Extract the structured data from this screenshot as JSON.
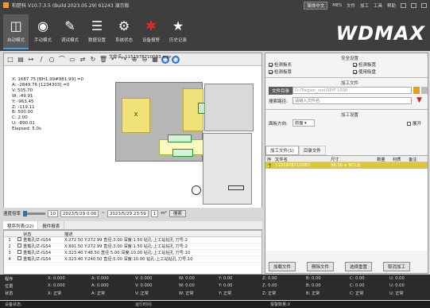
{
  "app": {
    "title": "柏楚科 V10.7.3.5 (Build 2023.05.29) 61243 演示版",
    "menu": [
      "简体中文",
      "MES",
      "文件",
      "加工",
      "工具",
      "帮助"
    ],
    "lang": "简体中文"
  },
  "modes": [
    {
      "label": "自动模式",
      "icon": "monitor-icon"
    },
    {
      "label": "手动模式",
      "icon": "mouse-icon"
    },
    {
      "label": "调试模式",
      "icon": "edit-icon"
    },
    {
      "label": "数据设置",
      "icon": "list-icon"
    },
    {
      "label": "系统状态",
      "icon": "gear-icon"
    },
    {
      "label": "设备报警",
      "icon": "alarm-icon"
    },
    {
      "label": "历史记录",
      "icon": "star-icon"
    }
  ],
  "logo": "WDMAX",
  "file": {
    "label": "文件名",
    "name": "1151978710083.mpr"
  },
  "canvas_info": [
    "X: 1687.75 [BH1.99#981.99] =0",
    "A: -2849.76 [1234303] =0",
    "V: 505.70",
    "W: -49.91",
    "Y: -963.45",
    "Z: -119.11",
    "B: 500.00",
    "C: 2.00",
    "U: -890.01",
    "Elapsed: 5.0s"
  ],
  "controls": {
    "speed_label": "速度倍率",
    "speed_value": "10",
    "date_from": "2023/5/29 0:00",
    "date_sep": "~",
    "date_to": "2023/5/29 23:59",
    "count_value": "1",
    "count_unit": "m²",
    "search_label": "搜索"
  },
  "bottom_tabs": [
    "程序列表(22)",
    "报件报表"
  ],
  "table": {
    "headers": [
      "",
      "状态",
      "描述"
    ],
    "rows": [
      {
        "no": "1",
        "status": "重载孔/Z-/G54",
        "desc": "X:272.50 Y:272.99 直径:3.00 深度:1.50 钻孔:上工站钻孔 刀号:2"
      },
      {
        "no": "2",
        "status": "重载孔/Z-/G54",
        "desc": "X:891.50 Y:272.99 直径:3.00 深度:1.50 钻孔:上工站钻孔 刀号:2"
      },
      {
        "no": "3",
        "status": "重载孔/Z-/G54",
        "desc": "X:323.40 Y:48.50 直径:5.00 深度:10.00 钻孔:上工站钻孔 刀号:10"
      },
      {
        "no": "4",
        "status": "重载孔/Z-/G54",
        "desc": "X:323.40 Y:240.50 直径:5.00 深度:10.00 钻孔:上工站钻孔 刀号:10"
      }
    ]
  },
  "right": {
    "safety_title": "安全设置",
    "checks": [
      {
        "label": "检测板长",
        "on": true
      },
      {
        "label": "检测板宽",
        "on": true
      },
      {
        "label": "检测板厚",
        "on": true
      },
      {
        "label": "使用吸盘",
        "on": true
      }
    ],
    "file_title": "加工文件",
    "dir_btn": "文件目录",
    "dir_path": "D:/Tregion_xmi/SP/F 1000",
    "search_label": "搜索路径:",
    "search_placeholder": "请输入文件名",
    "setting_title": "加工设置",
    "direction_label": "面板方向:",
    "direction_value": "前面",
    "expand_label": "展开",
    "list_tabs": [
      "加工文件(1)",
      "目录文件"
    ],
    "list_headers": [
      "序号",
      "文件名",
      "尺寸",
      "数量",
      "材质",
      "备注"
    ],
    "list_rows": [
      {
        "idx": "1",
        "name": "1151978710083",
        "size": "98.30 x 303.9",
        "qty": "",
        "mat": "",
        "note": ""
      }
    ],
    "buttons": [
      "加载文件",
      "删除文件",
      "选择重置",
      "取消加工"
    ]
  },
  "status": {
    "rows": [
      "程序",
      "位置",
      "状态"
    ],
    "cells": [
      [
        "X: 0.000",
        "A: 0.000",
        "V: 0.000",
        "W: 0.00",
        "Y: 0.00",
        "Z: 0.00",
        "B: 0.00",
        "C: 0.00",
        "U: 0.00"
      ],
      [
        "X: 0.000",
        "A: 0.000",
        "V: 0.000",
        "W: 0.00",
        "Y: 0.00",
        "Z: 0.00",
        "B: 0.00",
        "C: 0.00",
        "U: 0.00"
      ],
      [
        "X: 正常",
        "A: 正常",
        "V: 正常",
        "W: 正常",
        "Y: 正常",
        "Z: 正常",
        "B: 正常",
        "C: 正常",
        "U: 正常"
      ]
    ]
  },
  "footer": [
    "设备状态:",
    "运行时间:",
    "报警数量:0"
  ],
  "colors": {
    "accent": "#3aa0e8",
    "selection": "#ddc63a",
    "alarm": "#e02828"
  }
}
